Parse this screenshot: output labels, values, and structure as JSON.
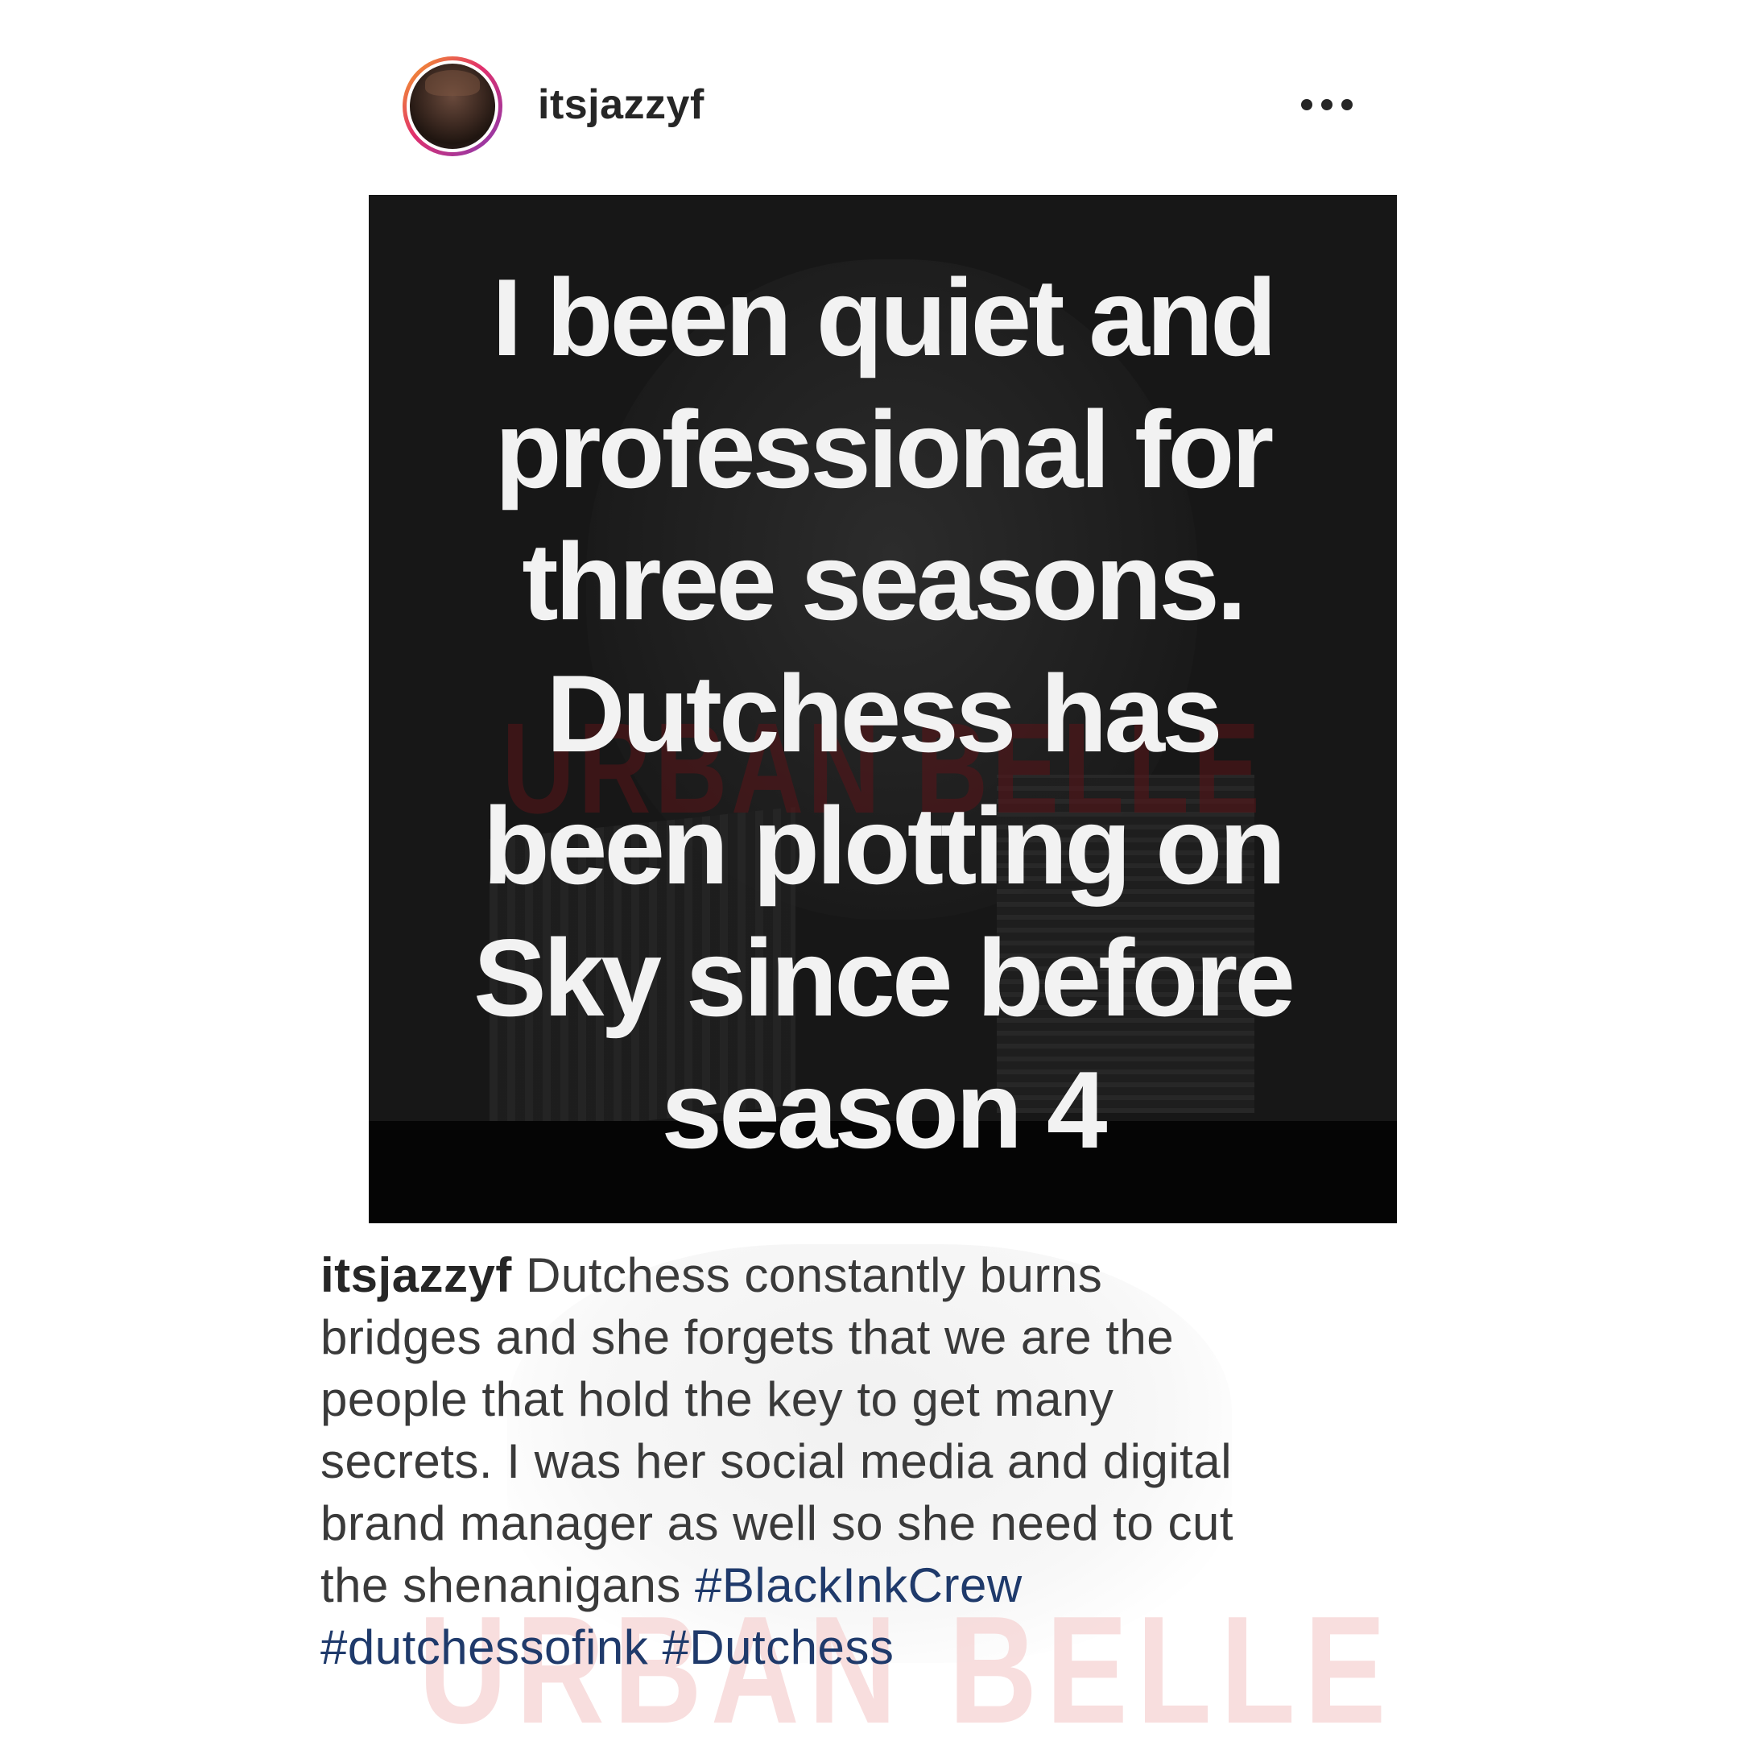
{
  "post": {
    "username": "itsjazzyf",
    "more_icon": "more-horizontal-icon",
    "image": {
      "overlay_lines": [
        "I been quiet and",
        "professional for",
        "three seasons.",
        "Dutchess has",
        "been plotting on",
        "Sky since before",
        "season 4"
      ],
      "watermark": "URBAN BELLE"
    },
    "caption": {
      "author": "itsjazzyf",
      "lines": [
        " Dutchess constantly burns",
        "bridges and she forgets that we are the",
        "people that hold the key to get many",
        "secrets. I was her social media and digital",
        "brand manager as well so she need to cut",
        "the shenanigans "
      ],
      "hashtags": [
        "#BlackInkCrew",
        "#dutchessofink",
        "#Dutchess"
      ],
      "watermark": "URBAN BELLE"
    }
  }
}
